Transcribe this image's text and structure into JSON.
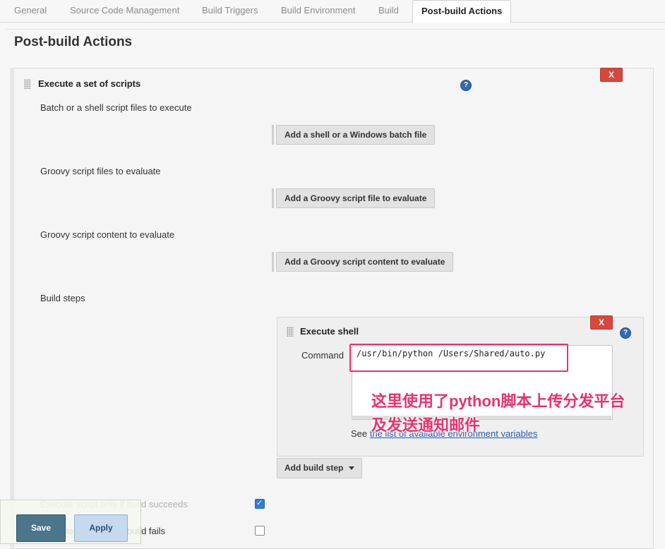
{
  "tabs": [
    {
      "label": "General"
    },
    {
      "label": "Source Code Management"
    },
    {
      "label": "Build Triggers"
    },
    {
      "label": "Build Environment"
    },
    {
      "label": "Build"
    },
    {
      "label": "Post-build Actions"
    }
  ],
  "section_title": "Post-build Actions",
  "execute_scripts": {
    "heading": "Execute a set of scripts",
    "delete_label": "X",
    "help_icon": "?",
    "batch_label": "Batch or a shell script files to execute",
    "batch_button": "Add a shell or a Windows batch file",
    "groovy_files_label": "Groovy script files to evaluate",
    "groovy_files_button": "Add a Groovy script file to evaluate",
    "groovy_content_label": "Groovy script content to evaluate",
    "groovy_content_button": "Add a Groovy script content to evaluate",
    "build_steps_label": "Build steps"
  },
  "execute_shell": {
    "heading": "Execute shell",
    "delete_label": "X",
    "help_icon": "?",
    "command_label": "Command",
    "command_value": "/usr/bin/python /Users/Shared/auto.py",
    "see_prefix": "See ",
    "see_link": "the list of available environment variables"
  },
  "annotation": {
    "line1": "这里使用了python脚本上传分发平台",
    "line2": "及发送通知邮件",
    "color": "#e6336e"
  },
  "add_build_step": "Add build step",
  "options": {
    "only_if_success_label": "Execute script only if build succeeds",
    "only_if_success_checked": true,
    "only_if_fails_label": "Execute script only if build fails",
    "only_if_fails_checked": false
  },
  "footer": {
    "save": "Save",
    "apply": "Apply"
  }
}
